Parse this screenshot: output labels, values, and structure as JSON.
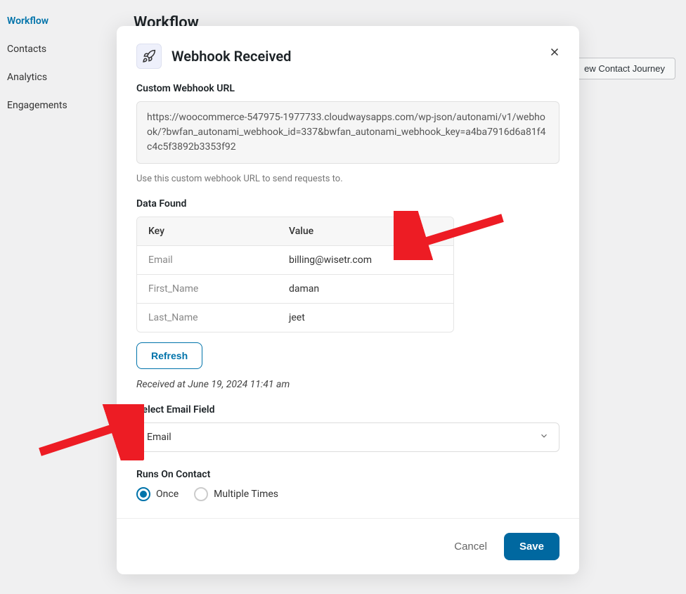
{
  "sidebar": {
    "items": [
      {
        "label": "Workflow",
        "active": true
      },
      {
        "label": "Contacts",
        "active": false
      },
      {
        "label": "Analytics",
        "active": false
      },
      {
        "label": "Engagements",
        "active": false
      }
    ]
  },
  "background": {
    "page_title": "Workflow",
    "new_journey_button": "ew Contact Journey"
  },
  "modal": {
    "title": "Webhook Received",
    "icon": "rocket",
    "webhook_url_label": "Custom Webhook URL",
    "webhook_url_value": "https://woocommerce-547975-1977733.cloudwaysapps.com/wp-json/autonami/v1/webhook/?bwfan_autonami_webhook_id=337&bwfan_autonami_webhook_key=a4ba7916d6a81f4c4c5f3892b3353f92",
    "webhook_url_helper": "Use this custom webhook URL to send requests to.",
    "data_found_label": "Data Found",
    "table": {
      "headers": {
        "key": "Key",
        "value": "Value"
      },
      "rows": [
        {
          "key": "Email",
          "value": "billing@wisetr.com"
        },
        {
          "key": "First_Name",
          "value": "daman"
        },
        {
          "key": "Last_Name",
          "value": "jeet"
        }
      ]
    },
    "refresh_button": "Refresh",
    "received_at": "Received at June 19, 2024 11:41 am",
    "select_email_label": "Select Email Field",
    "select_email_value": "Email",
    "runs_on_label": "Runs On Contact",
    "radio_options": {
      "once": "Once",
      "multiple": "Multiple Times",
      "selected": "once"
    },
    "footer": {
      "cancel": "Cancel",
      "save": "Save"
    }
  }
}
